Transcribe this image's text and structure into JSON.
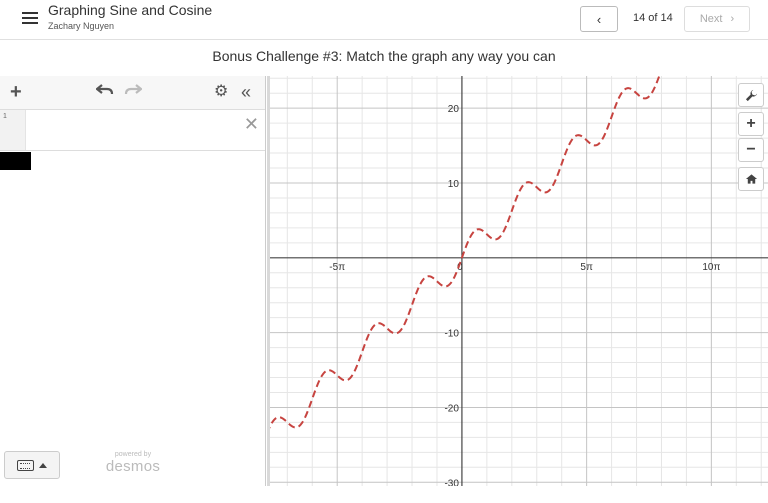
{
  "header": {
    "menu_icon": "hamburger-menu-icon",
    "title": "Graphing Sine and Cosine",
    "author": "Zachary Nguyen",
    "prev_icon": "chevron-left-icon",
    "page_count": "14 of 14",
    "next_label": "Next",
    "next_icon": "chevron-right-icon"
  },
  "challenge_title": "Bonus Challenge #3: Match the graph any way you can",
  "expression_panel": {
    "toolbar": {
      "add_icon": "plus-icon",
      "undo_icon": "undo-icon",
      "redo_icon": "redo-icon",
      "settings_icon": "gear-icon",
      "collapse_icon": "double-chevron-left-icon"
    },
    "expressions": [
      {
        "number": "1",
        "value": "",
        "delete_icon": "close-icon"
      }
    ],
    "keyboard_icon": "keyboard-icon",
    "powered_by": "powered by",
    "brand": "desmos"
  },
  "graph_controls": {
    "settings_icon": "wrench-icon",
    "zoom_in": "+",
    "zoom_out": "−",
    "home_icon": "home-icon"
  },
  "chart_data": {
    "type": "line",
    "title": "",
    "xlabel": "",
    "ylabel": "",
    "x_ticks": [
      {
        "value": -15.708,
        "label": "-5π"
      },
      {
        "value": 0,
        "label": "0"
      },
      {
        "value": 15.708,
        "label": "5π"
      },
      {
        "value": 31.416,
        "label": "10π"
      }
    ],
    "y_ticks": [
      {
        "value": 20,
        "label": "20"
      },
      {
        "value": 10,
        "label": "10"
      },
      {
        "value": -10,
        "label": "-10"
      },
      {
        "value": -20,
        "label": "-20"
      },
      {
        "value": -30,
        "label": "-30"
      }
    ],
    "xlim": [
      -24.55,
      38.55
    ],
    "ylim": [
      -30.5,
      24.3
    ],
    "grid": true,
    "series": [
      {
        "expression": "y = x + 2 sin(x)",
        "style": "dashed",
        "color": "#c74440"
      }
    ]
  }
}
